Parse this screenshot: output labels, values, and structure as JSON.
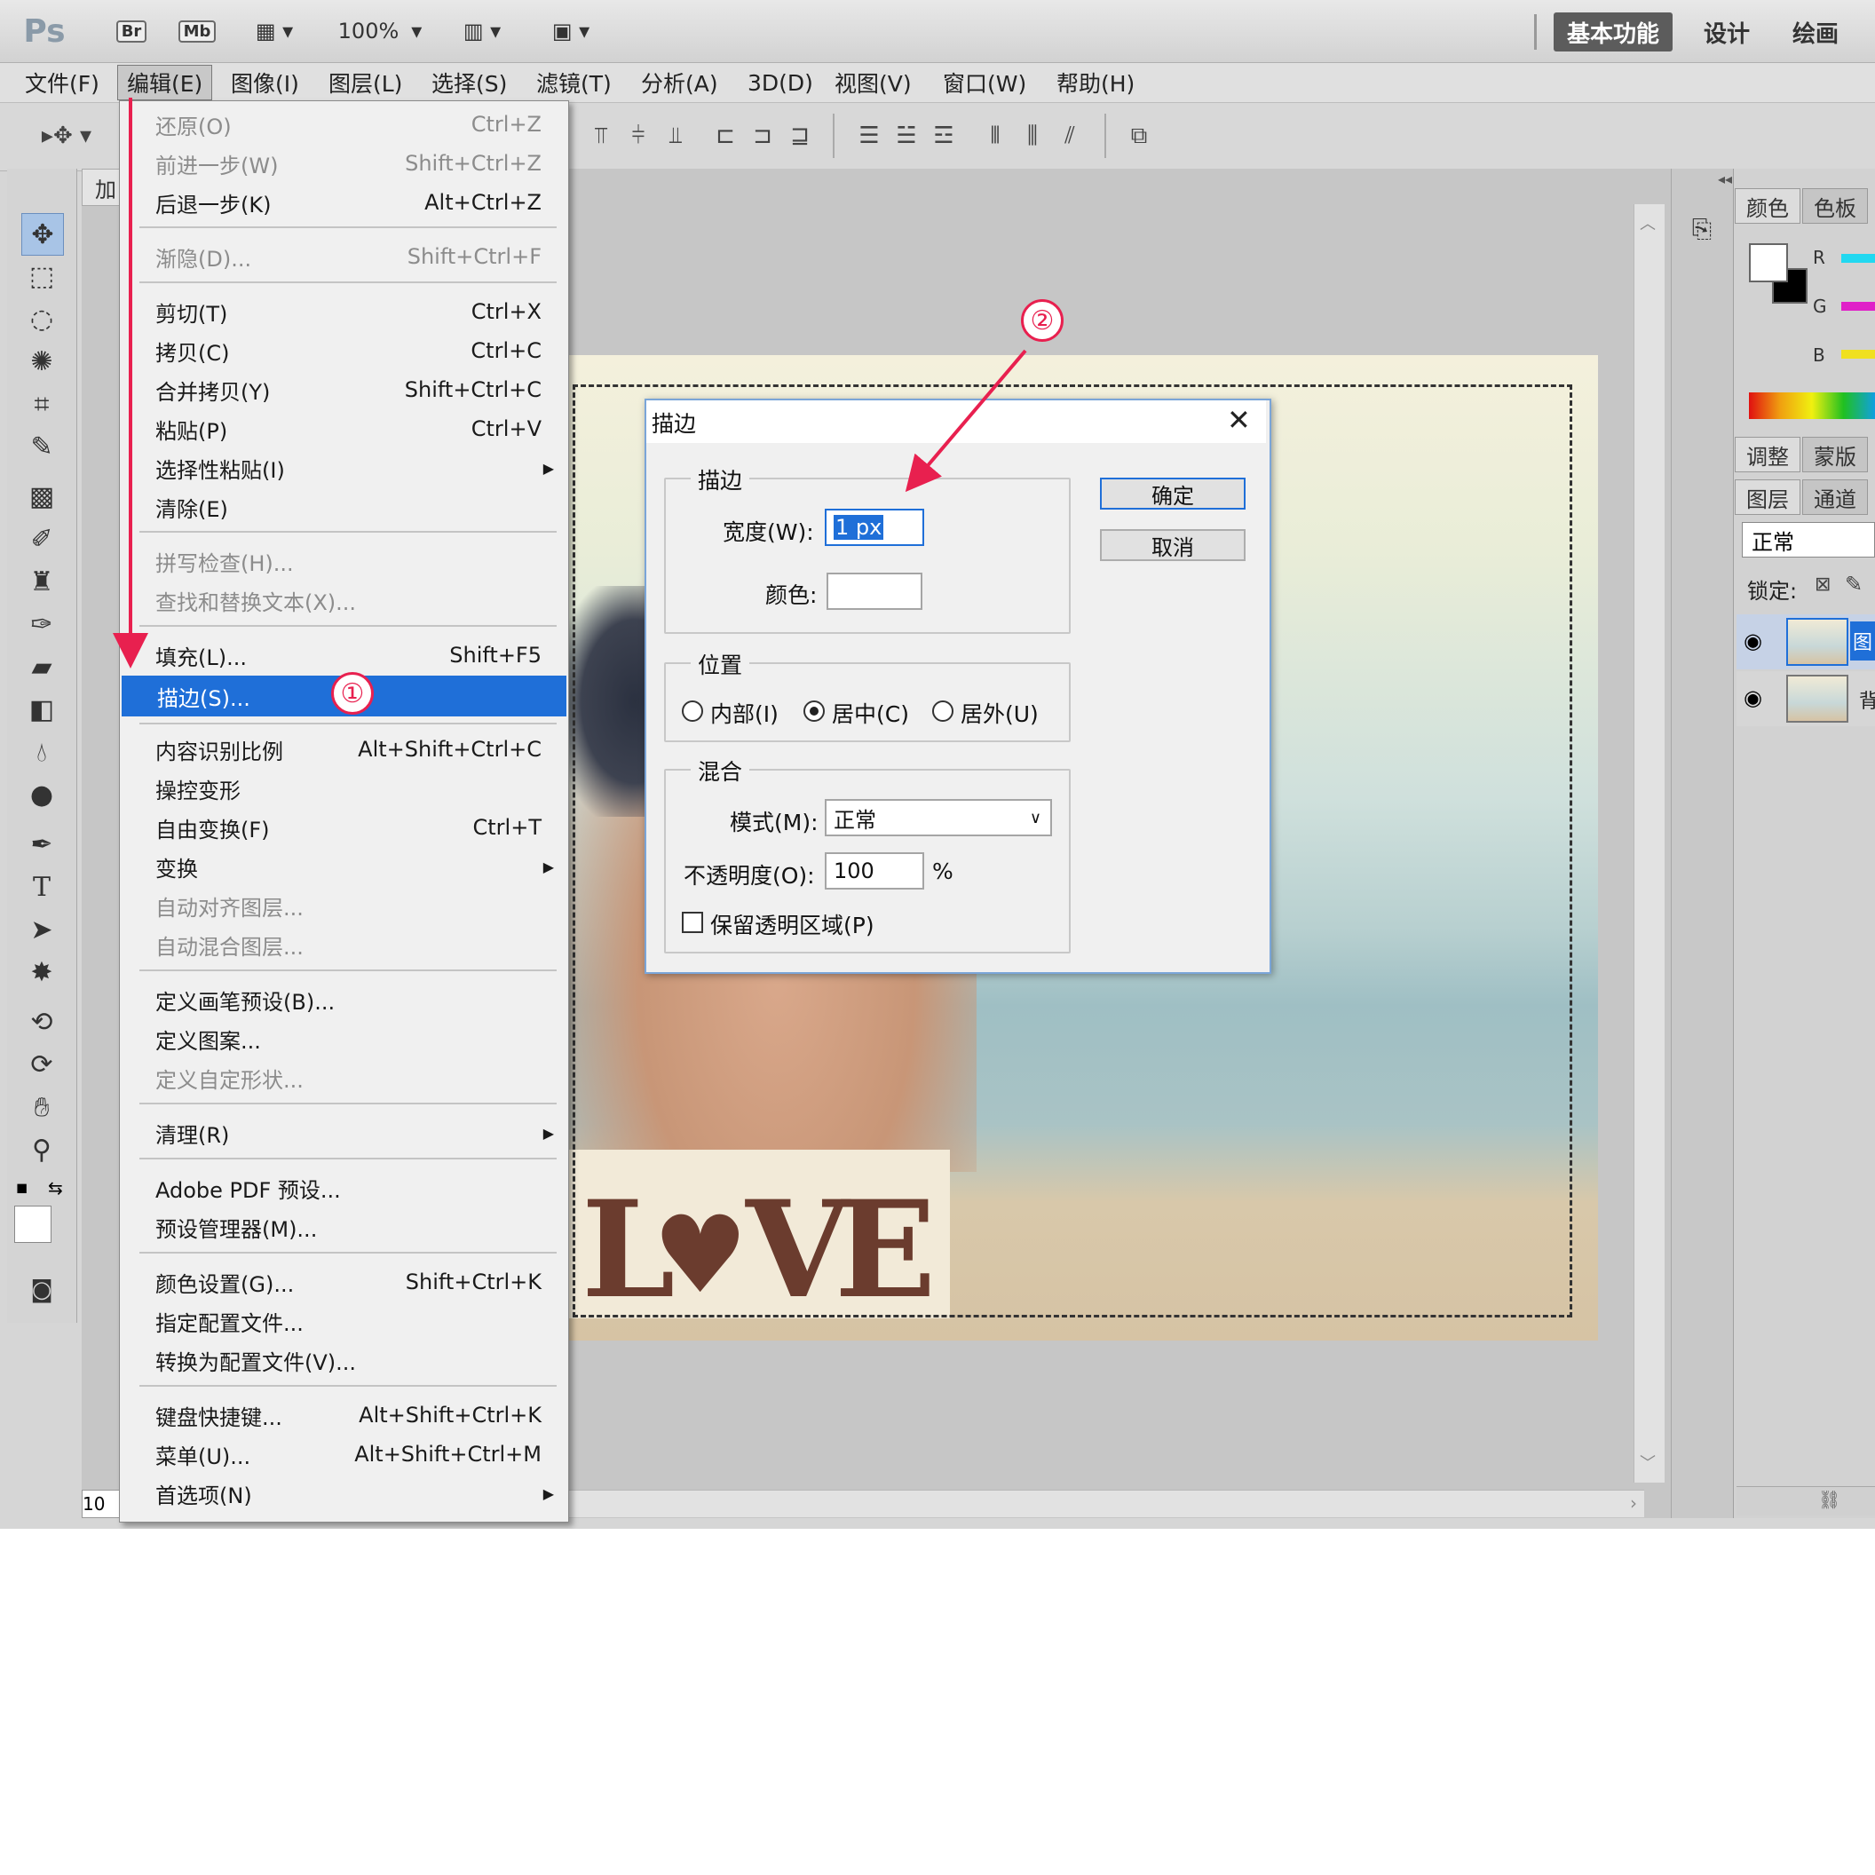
{
  "titlebar": {
    "logo": "Ps",
    "btn_br": "Br",
    "btn_mb": "Mb",
    "zoom": "100%",
    "workspaces": [
      "基本功能",
      "设计",
      "绘画"
    ]
  },
  "menubar": [
    "文件(F)",
    "编辑(E)",
    "图像(I)",
    "图层(L)",
    "选择(S)",
    "滤镜(T)",
    "分析(A)",
    "3D(D)",
    "视图(V)",
    "窗口(W)",
    "帮助(H)"
  ],
  "document": {
    "tab_label": "加",
    "zoom_field": "10",
    "photo_text": [
      "L",
      "V",
      "E"
    ]
  },
  "edit_menu": [
    {
      "label": "还原(O)",
      "shortcut": "Ctrl+Z",
      "disabled": true
    },
    {
      "label": "前进一步(W)",
      "shortcut": "Shift+Ctrl+Z",
      "disabled": true
    },
    {
      "label": "后退一步(K)",
      "shortcut": "Alt+Ctrl+Z"
    },
    {
      "label": "渐隐(D)...",
      "shortcut": "Shift+Ctrl+F",
      "disabled": true
    },
    {
      "label": "剪切(T)",
      "shortcut": "Ctrl+X"
    },
    {
      "label": "拷贝(C)",
      "shortcut": "Ctrl+C"
    },
    {
      "label": "合并拷贝(Y)",
      "shortcut": "Shift+Ctrl+C"
    },
    {
      "label": "粘贴(P)",
      "shortcut": "Ctrl+V"
    },
    {
      "label": "选择性粘贴(I)",
      "shortcut": ""
    },
    {
      "label": "清除(E)",
      "shortcut": ""
    },
    {
      "label": "拼写检查(H)...",
      "shortcut": "",
      "disabled": true
    },
    {
      "label": "查找和替换文本(X)...",
      "shortcut": "",
      "disabled": true
    },
    {
      "label": "填充(L)...",
      "shortcut": "Shift+F5"
    },
    {
      "label": "描边(S)...",
      "shortcut": "",
      "highlighted": true
    },
    {
      "label": "内容识别比例",
      "shortcut": "Alt+Shift+Ctrl+C"
    },
    {
      "label": "操控变形",
      "shortcut": ""
    },
    {
      "label": "自由变换(F)",
      "shortcut": "Ctrl+T"
    },
    {
      "label": "变换",
      "shortcut": ""
    },
    {
      "label": "自动对齐图层...",
      "shortcut": "",
      "disabled": true
    },
    {
      "label": "自动混合图层...",
      "shortcut": "",
      "disabled": true
    },
    {
      "label": "定义画笔预设(B)...",
      "shortcut": ""
    },
    {
      "label": "定义图案...",
      "shortcut": ""
    },
    {
      "label": "定义自定形状...",
      "shortcut": "",
      "disabled": true
    },
    {
      "label": "清理(R)",
      "shortcut": ""
    },
    {
      "label": "Adobe PDF 预设...",
      "shortcut": ""
    },
    {
      "label": "预设管理器(M)...",
      "shortcut": ""
    },
    {
      "label": "颜色设置(G)...",
      "shortcut": "Shift+Ctrl+K"
    },
    {
      "label": "指定配置文件...",
      "shortcut": ""
    },
    {
      "label": "转换为配置文件(V)...",
      "shortcut": ""
    },
    {
      "label": "键盘快捷键...",
      "shortcut": "Alt+Shift+Ctrl+K"
    },
    {
      "label": "菜单(U)...",
      "shortcut": "Alt+Shift+Ctrl+M"
    },
    {
      "label": "首选项(N)",
      "shortcut": ""
    }
  ],
  "dialog": {
    "title": "描边",
    "group_stroke": "描边",
    "width_label": "宽度(W):",
    "width_value": "1 px",
    "color_label": "颜色:",
    "group_location": "位置",
    "radio_inside": "内部(I)",
    "radio_center": "居中(C)",
    "radio_outside": "居外(U)",
    "group_blending": "混合",
    "mode_label": "模式(M):",
    "mode_value": "正常",
    "opacity_label": "不透明度(O):",
    "opacity_value": "100",
    "opacity_unit": "%",
    "preserve_label": "保留透明区域(P)",
    "ok_label": "确定",
    "cancel_label": "取消"
  },
  "right_panel": {
    "tab_color": "颜色",
    "tab_swatches": "色板",
    "chan_r": "R",
    "chan_g": "G",
    "chan_b": "B",
    "tab_adjust": "调整",
    "tab_mask": "蒙版",
    "tab_layers": "图层",
    "tab_channels": "通道",
    "blend_mode": "正常",
    "lock_label": "锁定:",
    "layer1_name": "图",
    "layer2_name": "背"
  },
  "annotations": {
    "step1": "①",
    "step2": "②"
  },
  "colors": {
    "highlight": "#1f6fd8",
    "annotation": "#e8204f"
  }
}
